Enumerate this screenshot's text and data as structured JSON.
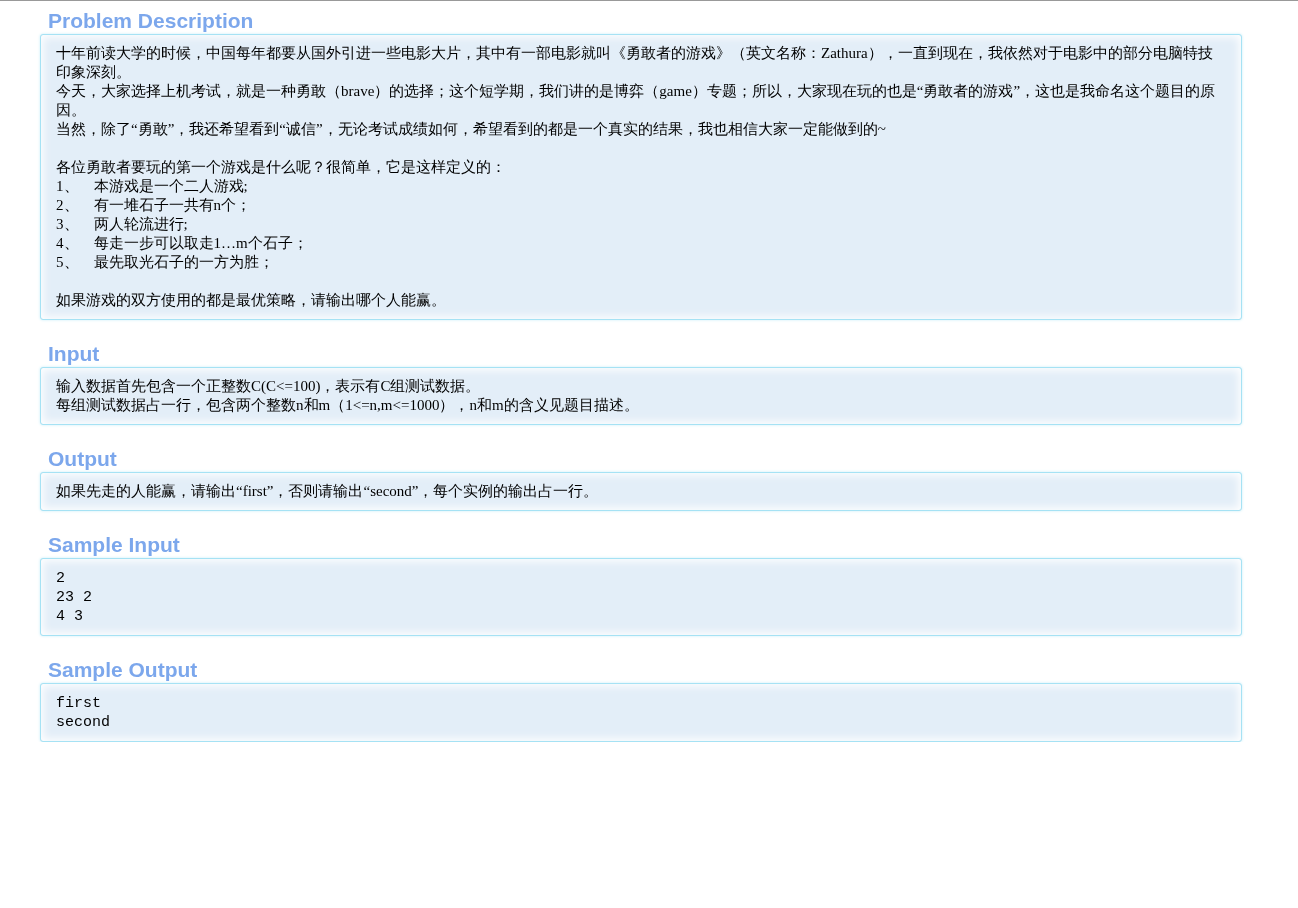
{
  "sections": [
    {
      "title": "Problem Description",
      "kind": "text",
      "blocks": [
        [
          "十年前读大学的时候，中国每年都要从国外引进一些电影大片，其中有一部电影就叫《勇敢者的游戏》（英文名称：Zathura），一直到现在，我依然对于电影中的部分电脑特技印象深刻。",
          "今天，大家选择上机考试，就是一种勇敢（brave）的选择；这个短学期，我们讲的是博弈（game）专题；所以，大家现在玩的也是“勇敢者的游戏”，这也是我命名这个题目的原因。",
          "当然，除了“勇敢”，我还希望看到“诚信”，无论考试成绩如何，希望看到的都是一个真实的结果，我也相信大家一定能做到的~"
        ],
        [
          "各位勇敢者要玩的第一个游戏是什么呢？很简单，它是这样定义的：",
          "1、　本游戏是一个二人游戏;",
          "2、　有一堆石子一共有n个；",
          "3、　两人轮流进行;",
          "4、　每走一步可以取走1…m个石子；",
          "5、　最先取光石子的一方为胜；"
        ],
        [
          "如果游戏的双方使用的都是最优策略，请输出哪个人能赢。"
        ]
      ]
    },
    {
      "title": "Input",
      "kind": "text",
      "blocks": [
        [
          "输入数据首先包含一个正整数C(C<=100)，表示有C组测试数据。",
          "每组测试数据占一行，包含两个整数n和m（1<=n,m<=1000），n和m的含义见题目描述。"
        ]
      ]
    },
    {
      "title": "Output",
      "kind": "text",
      "blocks": [
        [
          "如果先走的人能赢，请输出“first”，否则请输出“second”，每个实例的输出占一行。"
        ]
      ]
    },
    {
      "title": "Sample Input",
      "kind": "code",
      "blocks": [
        [
          "2",
          "23 2",
          "4 3"
        ]
      ]
    },
    {
      "title": "Sample Output",
      "kind": "code",
      "blocks": [
        [
          "first",
          "second"
        ]
      ]
    }
  ]
}
